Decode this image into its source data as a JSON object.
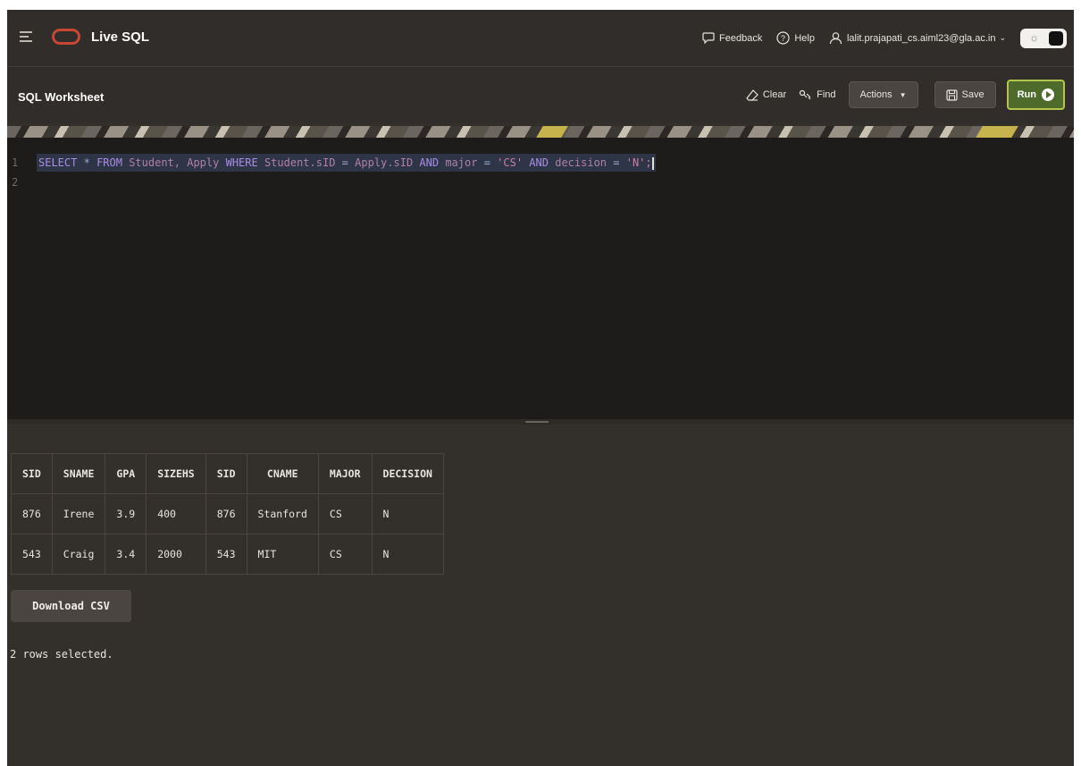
{
  "header": {
    "app_title": "Live SQL",
    "links": {
      "feedback": "Feedback",
      "help": "Help",
      "user": "lalit.prajapati_cs.aiml23@gla.ac.in"
    }
  },
  "toolbar": {
    "title": "SQL Worksheet",
    "clear": "Clear",
    "find": "Find",
    "actions": "Actions",
    "save": "Save",
    "run": "Run"
  },
  "editor": {
    "lines": [
      {
        "num": "1"
      },
      {
        "num": "2"
      }
    ],
    "tokens": {
      "select": "SELECT",
      "star": "*",
      "from": "FROM",
      "student": "Student,",
      "apply": "Apply",
      "where": "WHERE",
      "student_sid": "Student.sID",
      "eq1": "=",
      "apply_sid": "Apply.sID",
      "and1": "AND",
      "major": "major",
      "eq2": "=",
      "cs": "'CS'",
      "and2": "AND",
      "decision": "decision",
      "eq3": "=",
      "n": "'N';"
    }
  },
  "results": {
    "columns": [
      "SID",
      "SNAME",
      "GPA",
      "SIZEHS",
      "SID",
      "CNAME",
      "MAJOR",
      "DECISION"
    ],
    "rows": [
      [
        "876",
        "Irene",
        "3.9",
        "400",
        "876",
        "Stanford",
        "CS",
        "N"
      ],
      [
        "543",
        "Craig",
        "3.4",
        "2000",
        "543",
        "MIT",
        "CS",
        "N"
      ]
    ],
    "download_label": "Download CSV",
    "status": "2 rows selected."
  },
  "colors": {
    "background": "#332f2b",
    "editor_bg": "#1d1c1b",
    "logo_red": "#c74634",
    "run_green": "#4f6b2c",
    "run_border": "#b5c54a"
  },
  "icons": [
    "hamburger-icon",
    "oracle-logo",
    "feedback-icon",
    "help-icon",
    "user-icon",
    "chevron-down-icon",
    "eraser-icon",
    "find-icon",
    "save-icon",
    "run-icon"
  ]
}
